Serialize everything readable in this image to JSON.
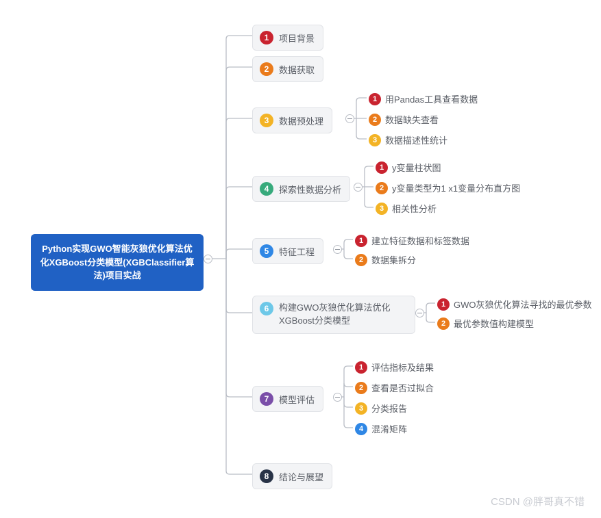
{
  "root": "Python实现GWO智能灰狼优化算法优化XGBoost分类模型(XGBClassifier算法)项目实战",
  "watermark": "CSDN @胖哥真不错",
  "level1": [
    {
      "n": "1",
      "c": "c1",
      "label": "项目背景"
    },
    {
      "n": "2",
      "c": "c2",
      "label": "数据获取"
    },
    {
      "n": "3",
      "c": "c3",
      "label": "数据预处理"
    },
    {
      "n": "4",
      "c": "c4",
      "label": "探索性数据分析"
    },
    {
      "n": "5",
      "c": "c5",
      "label": "特征工程"
    },
    {
      "n": "6",
      "c": "c6",
      "label": "构建GWO灰狼优化算法优化XGBoost分类模型"
    },
    {
      "n": "7",
      "c": "c7",
      "label": "模型评估"
    },
    {
      "n": "8",
      "c": "c8",
      "label": "结论与展望"
    }
  ],
  "children3": [
    {
      "n": "1",
      "c": "c1",
      "label": "用Pandas工具查看数据"
    },
    {
      "n": "2",
      "c": "c2",
      "label": "数据缺失查看"
    },
    {
      "n": "3",
      "c": "c3",
      "label": "数据描述性统计"
    }
  ],
  "children4": [
    {
      "n": "1",
      "c": "c1",
      "label": "y变量柱状图"
    },
    {
      "n": "2",
      "c": "c2",
      "label": "y变量类型为1 x1变量分布直方图"
    },
    {
      "n": "3",
      "c": "c3",
      "label": "相关性分析"
    }
  ],
  "children5": [
    {
      "n": "1",
      "c": "c1",
      "label": "建立特征数据和标签数据"
    },
    {
      "n": "2",
      "c": "c2",
      "label": "数据集拆分"
    }
  ],
  "children6": [
    {
      "n": "1",
      "c": "c1",
      "label": "GWO灰狼优化算法寻找的最优参数"
    },
    {
      "n": "2",
      "c": "c2",
      "label": "最优参数值构建模型"
    }
  ],
  "children7": [
    {
      "n": "1",
      "c": "c1",
      "label": "评估指标及结果"
    },
    {
      "n": "2",
      "c": "c2",
      "label": "查看是否过拟合"
    },
    {
      "n": "3",
      "c": "c3",
      "label": "分类报告"
    },
    {
      "n": "4",
      "c": "c5",
      "label": "混淆矩阵"
    }
  ]
}
